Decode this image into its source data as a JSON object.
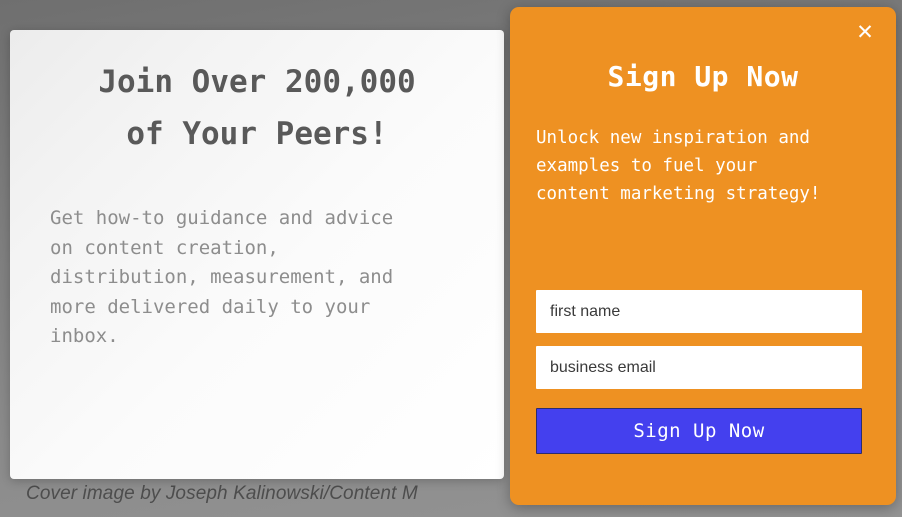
{
  "background": {
    "color_top": "#6f6f6f",
    "color_bottom": "#949494"
  },
  "caption": {
    "text": "Cover image by Joseph Kalinowski/Content M"
  },
  "article_card": {
    "heading_lines": [
      "Join Over 200,000",
      "of Your Peers!"
    ],
    "body_lines": [
      "Get how-to guidance and advice",
      "on content creation,",
      "distribution, measurement, and",
      "more delivered daily to your",
      "inbox."
    ],
    "heading_color": "#595959",
    "body_color": "#8d8d8d",
    "background_color": "#f7f7f7"
  },
  "signup_panel": {
    "accent_color": "#ee9122",
    "title": "Sign Up Now",
    "subtitle_lines": [
      "Unlock new inspiration and",
      "examples to fuel your",
      "content marketing strategy!"
    ],
    "close_icon": "✕",
    "close_icon_name": "close-icon",
    "fields": [
      {
        "name": "first-name",
        "placeholder": "first name",
        "value": ""
      },
      {
        "name": "business-email",
        "placeholder": "business email",
        "value": ""
      }
    ],
    "submit_label": "Sign Up Now",
    "submit_color": "#4440ee",
    "submit_text_color": "#ffffff"
  }
}
